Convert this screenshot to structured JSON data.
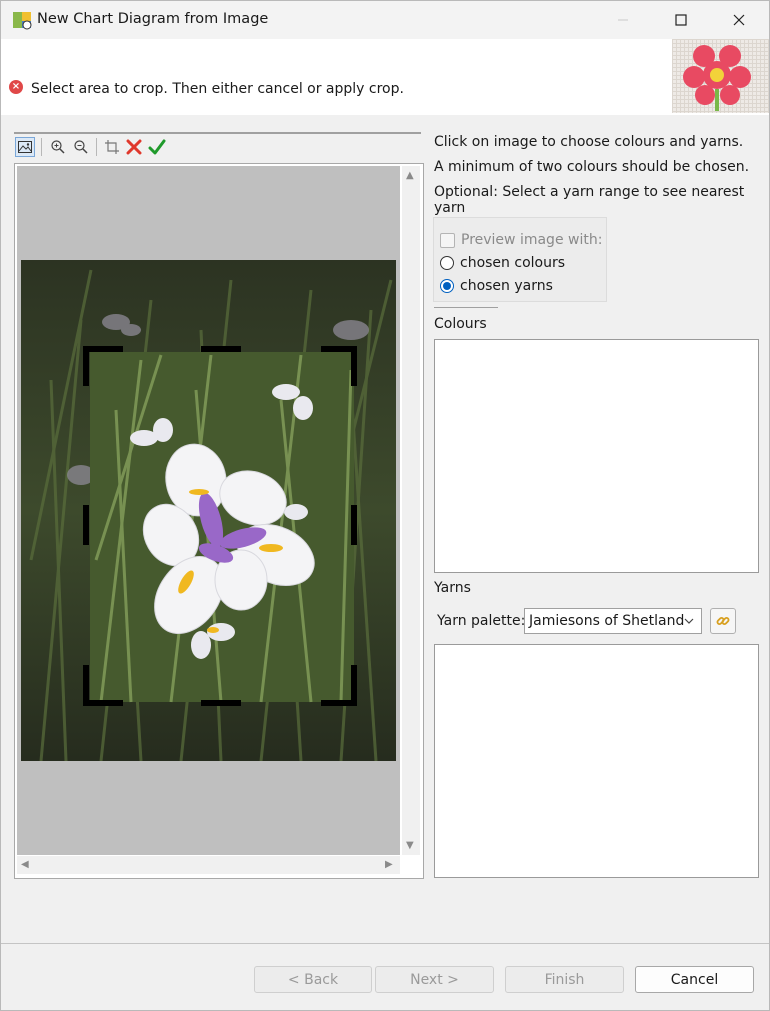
{
  "window": {
    "title": "New Chart Diagram from Image"
  },
  "header": {
    "message": "Select area to crop. Then either cancel or apply crop.",
    "message_icon": "error-icon"
  },
  "toolbar": {
    "icons": [
      "image-icon",
      "zoom-in-icon",
      "zoom-out-icon",
      "crop-icon",
      "cancel-crop-icon",
      "apply-crop-icon"
    ]
  },
  "instructions": {
    "line1": "Click on image to choose colours and yarns.",
    "line2": "A minimum of two colours should be chosen.",
    "line3": "Optional: Select a yarn range to see nearest yarn"
  },
  "preview": {
    "checkbox_label": "Preview image with:",
    "checked": false,
    "option_colours": "chosen colours",
    "option_yarns": "chosen yarns",
    "selected": "chosen yarns"
  },
  "colours": {
    "label": "Colours"
  },
  "yarns": {
    "label": "Yarns",
    "palette_label": "Yarn palette:",
    "palette_value": "Jamiesons of Shetland"
  },
  "footer": {
    "back": "< Back",
    "next": "Next >",
    "finish": "Finish",
    "cancel": "Cancel"
  },
  "colors": {
    "accent": "#0060c0",
    "error": "#e04848",
    "cancel_red": "#e0382c",
    "apply_green": "#1f9a2b"
  }
}
